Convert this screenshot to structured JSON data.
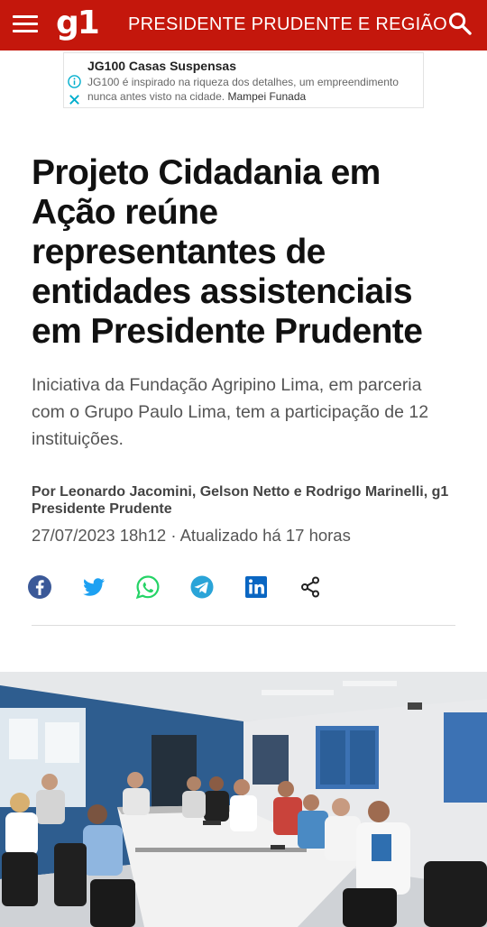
{
  "header": {
    "logo": "g1",
    "section": "PRESIDENTE PRUDENTE E  REGIÃO",
    "menu_icon": "hamburger-menu-icon",
    "search_icon": "search-icon",
    "background_color": "#c4170c"
  },
  "ad": {
    "title": "JG100 Casas Suspensas",
    "description": "JG100 é inspirado na riqueza dos detalhes, um empreendimento nunca antes visto na cidade.",
    "advertiser": "Mampei Funada",
    "info_icon": "info-icon",
    "close_icon": "close-icon"
  },
  "article": {
    "title": "Projeto Cidadania em Ação reúne representantes de entidades assistenciais em Presidente Prudente",
    "summary": "Iniciativa da Fundação Agripino Lima, em parceria com o Grupo Paulo Lima, tem a participação de 12 instituições.",
    "byline": "Por Leonardo Jacomini, Gelson Netto e Rodrigo Marinelli, g1 Presidente Prudente",
    "date": "27/07/2023 18h12 · Atualizado há 17 horas"
  },
  "share": [
    {
      "icon": "facebook-icon",
      "color": "#3b5998"
    },
    {
      "icon": "twitter-icon",
      "color": "#1da1f2"
    },
    {
      "icon": "whatsapp-icon",
      "color": "#25d366"
    },
    {
      "icon": "telegram-icon",
      "color": "#2aa4d8"
    },
    {
      "icon": "linkedin-icon",
      "color": "#0a66c2"
    },
    {
      "icon": "share-icon",
      "color": "#222222"
    }
  ]
}
